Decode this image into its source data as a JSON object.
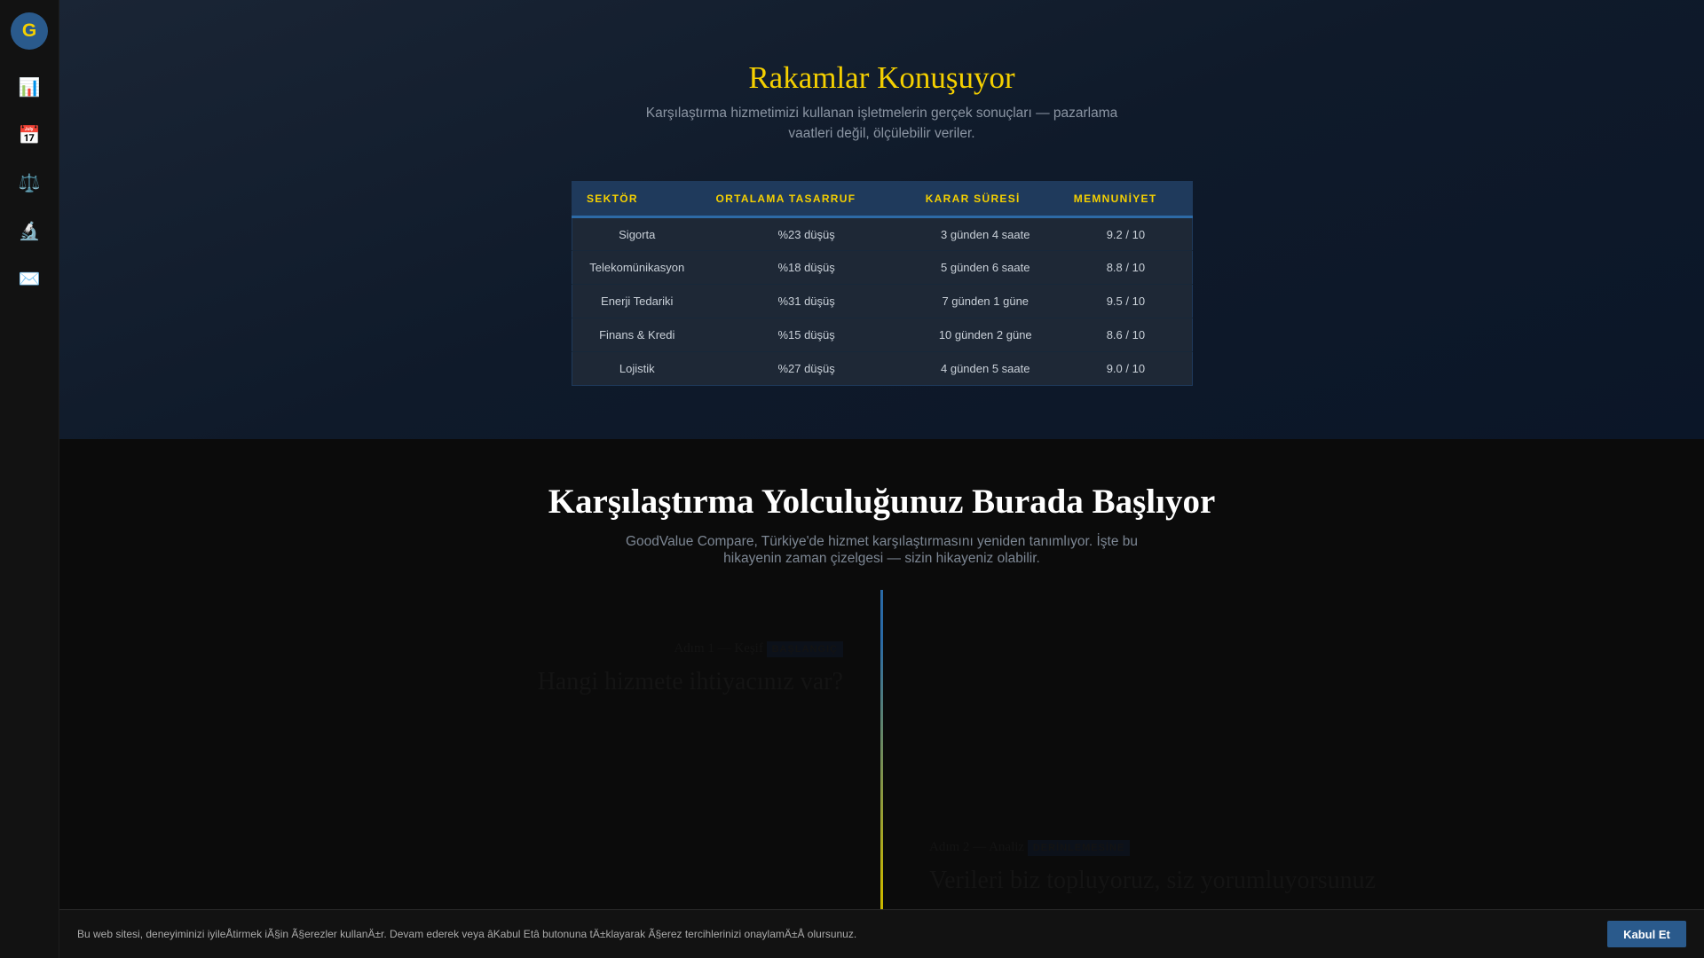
{
  "sidebar": {
    "logo": "G",
    "items": [
      {
        "icon": "📊",
        "name": "chart"
      },
      {
        "icon": "📅",
        "name": "calendar"
      },
      {
        "icon": "⚖️",
        "name": "scales"
      },
      {
        "icon": "🔬",
        "name": "microscope"
      },
      {
        "icon": "✉️",
        "name": "mail"
      }
    ]
  },
  "stats": {
    "title": "Rakamlar Konuşuyor",
    "subtitle": "Karşılaştırma hizmetimizi kullanan işletmelerin gerçek sonuçları — pazarlama vaatleri değil, ölçülebilir veriler.",
    "headers": [
      "SEKTÖR",
      "ORTALAMA TASARRUF",
      "KARAR SÜRESİ",
      "MEMNUNİYET"
    ],
    "rows": [
      [
        "Sigorta",
        "%23 düşüş",
        "3 günden 4 saate",
        "9.2 / 10"
      ],
      [
        "Telekomünikasyon",
        "%18 düşüş",
        "5 günden 6 saate",
        "8.8 / 10"
      ],
      [
        "Enerji Tedariki",
        "%31 düşüş",
        "7 günden 1 güne",
        "9.5 / 10"
      ],
      [
        "Finans & Kredi",
        "%15 düşüş",
        "10 günden 2 güne",
        "8.6 / 10"
      ],
      [
        "Lojistik",
        "%27 düşüş",
        "4 günden 5 saate",
        "9.0 / 10"
      ]
    ]
  },
  "journey": {
    "title": "Karşılaştırma Yolculuğunuz Burada Başlıyor",
    "subtitle": "GoodValue Compare, Türkiye'de hizmet karşılaştırmasını yeniden tanımlıyor. İşte bu hikayenin zaman çizelgesi — sizin hikayeniz olabilir.",
    "steps": [
      {
        "label": "Adım 1 — Keşif",
        "badge": "BAŞLANGIÇ",
        "title": "Hangi hizmete ihtiyacınız var?"
      },
      {
        "label": "Adım 2 — Analiz",
        "badge": "DERİNLEMESİNE",
        "title": "Verileri biz topluyoruz, siz yorumluyorsunuz"
      }
    ]
  },
  "cookie": {
    "text": "Bu web sitesi, deneyiminizi iyileÅtirmek iÃ§in Ã§erezler kullanÄ±r. Devam ederek veya âKabul Etâ butonuna tÄ±klayarak Ã§erez tercihlerinizi onaylamÄ±Å olursunuz.",
    "button": "Kabul Et"
  }
}
